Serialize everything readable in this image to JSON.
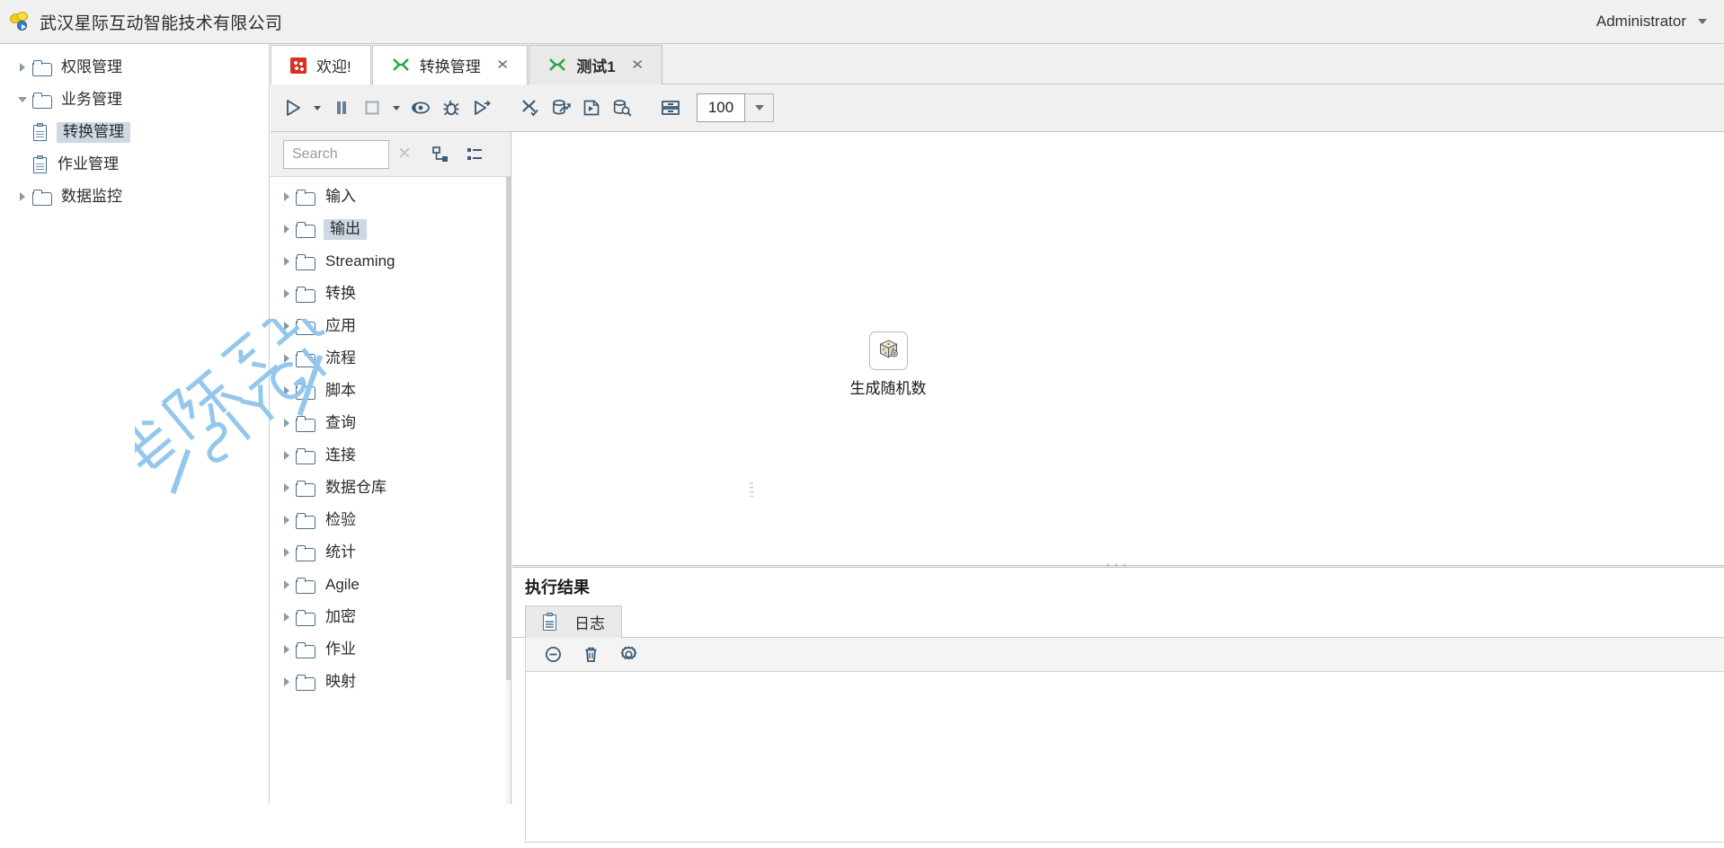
{
  "topbar": {
    "logo_icon": "app-logo-icon",
    "title": "武汉星际互动智能技术有限公司",
    "user": "Administrator",
    "user_caret_icon": "caret-down-icon"
  },
  "sidebar": {
    "items": [
      {
        "label": "权限管理",
        "icon": "folder-icon",
        "arrow": "triangle-right-icon",
        "level": 0,
        "selected": false
      },
      {
        "label": "业务管理",
        "icon": "folder-icon",
        "arrow": "triangle-down-icon",
        "level": 0,
        "selected": false
      },
      {
        "label": "转换管理",
        "icon": "document-icon",
        "arrow": "",
        "level": 1,
        "selected": true
      },
      {
        "label": "作业管理",
        "icon": "document-icon",
        "arrow": "",
        "level": 1,
        "selected": false
      },
      {
        "label": "数据监控",
        "icon": "folder-icon",
        "arrow": "triangle-right-icon",
        "level": 0,
        "selected": false
      }
    ]
  },
  "tabs": [
    {
      "label": "欢迎!",
      "icon": "welcome-icon",
      "closable": false,
      "active": false
    },
    {
      "label": "转换管理",
      "icon": "transformation-icon",
      "closable": true,
      "active": false
    },
    {
      "label": "测试1",
      "icon": "transformation-icon",
      "closable": true,
      "active": true
    }
  ],
  "toolbar": {
    "buttons": [
      {
        "name": "run-button",
        "icon": "play-icon"
      },
      {
        "name": "run-options-button",
        "icon": "caret-down-icon"
      },
      {
        "name": "pause-button",
        "icon": "pause-icon"
      },
      {
        "name": "stop-button",
        "icon": "stop-icon"
      },
      {
        "name": "stop-options-button",
        "icon": "caret-down-icon"
      },
      {
        "name": "preview-button",
        "icon": "preview-eye-icon"
      },
      {
        "name": "debug-button",
        "icon": "bug-icon"
      },
      {
        "name": "replay-button",
        "icon": "play-step-icon"
      },
      {
        "name": "verify-button",
        "icon": "verify-transformation-icon"
      },
      {
        "name": "impact-analysis-button",
        "icon": "database-arrow-icon"
      },
      {
        "name": "generate-sql-button",
        "icon": "sql-icon"
      },
      {
        "name": "explore-db-button",
        "icon": "database-search-icon"
      },
      {
        "name": "align-grid-button",
        "icon": "grid-snap-icon"
      }
    ],
    "zoom_value": "100",
    "zoom_caret_icon": "caret-down-icon"
  },
  "palette": {
    "search": {
      "value": "",
      "placeholder": "Search"
    },
    "clear_icon": "close-icon",
    "expand_icon": "expand-tree-icon",
    "collapse_icon": "collapse-tree-icon",
    "items": [
      {
        "label": "输入",
        "selected": false,
        "expandable": true
      },
      {
        "label": "输出",
        "selected": true,
        "expandable": true
      },
      {
        "label": "Streaming",
        "selected": false,
        "expandable": true
      },
      {
        "label": "转换",
        "selected": false,
        "expandable": true
      },
      {
        "label": "应用",
        "selected": false,
        "expandable": true
      },
      {
        "label": "流程",
        "selected": false,
        "expandable": true
      },
      {
        "label": "脚本",
        "selected": false,
        "expandable": true
      },
      {
        "label": "查询",
        "selected": false,
        "expandable": true
      },
      {
        "label": "连接",
        "selected": false,
        "expandable": true
      },
      {
        "label": "数据仓库",
        "selected": false,
        "expandable": true
      },
      {
        "label": "检验",
        "selected": false,
        "expandable": true
      },
      {
        "label": "统计",
        "selected": false,
        "expandable": true
      },
      {
        "label": "Agile",
        "selected": false,
        "expandable": true
      },
      {
        "label": "加密",
        "selected": false,
        "expandable": true
      },
      {
        "label": "作业",
        "selected": false,
        "expandable": true
      },
      {
        "label": "映射",
        "selected": false,
        "expandable": true
      }
    ]
  },
  "canvas": {
    "nodes": [
      {
        "label": "生成随机数",
        "icon": "random-number-die-icon"
      }
    ]
  },
  "result": {
    "title": "执行结果",
    "maximize_icon": "maximize-icon",
    "close_icon": "close-icon",
    "tabs": [
      {
        "label": "日志",
        "icon": "log-document-icon",
        "active": true
      }
    ],
    "log_toolbar": [
      {
        "name": "clear-log-button",
        "icon": "minus-circle-icon"
      },
      {
        "name": "delete-log-button",
        "icon": "trash-icon"
      },
      {
        "name": "log-settings-button",
        "icon": "gear-icon"
      }
    ],
    "log_text": ""
  },
  "watermark": {
    "text_cn": "星际互动",
    "text_en": "SIYGI",
    "color": "#8ec6ec"
  },
  "colors": {
    "accent": "#3d5a73",
    "selection": "#cdd8e4",
    "chrome": "#f0f0f0",
    "border": "#c9c9c9",
    "tab_green": "#2aa64a"
  }
}
